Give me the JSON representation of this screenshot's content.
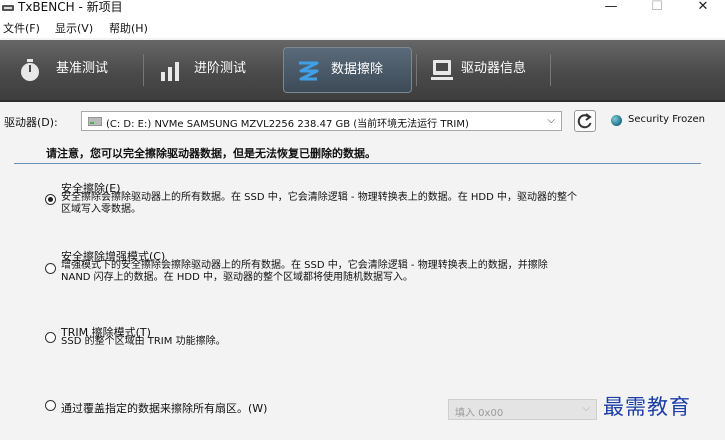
{
  "window": {
    "title": "TxBENCH - 新项目",
    "minimize": "—",
    "maximize": "☐",
    "close": "✕"
  },
  "menu": {
    "items": [
      "文件(F)",
      "显示(V)",
      "帮助(H)"
    ]
  },
  "tabs": [
    {
      "label": "基准测试",
      "icon": "stopwatch-icon",
      "active": false
    },
    {
      "label": "进阶测试",
      "icon": "bar-chart-icon",
      "active": false
    },
    {
      "label": "数据擦除",
      "icon": "erase-icon",
      "active": true
    },
    {
      "label": "驱动器信息",
      "icon": "drive-info-icon",
      "active": false
    }
  ],
  "drive": {
    "label": "驱动器(D):",
    "selected": "(C: D: E:) NVMe SAMSUNG MZVL2256  238.47 GB (当前环境无法运行 TRIM)",
    "security_status": "Security Frozen",
    "security_color": "#1c6f87"
  },
  "warning": "请注意，您可以完全擦除驱动器数据，但是无法恢复已删除的数据。",
  "options": [
    {
      "title": "安全擦除(E)",
      "selected": true,
      "desc": [
        "安全擦除会擦除驱动器上的所有数据。在 SSD 中，它会清除逻辑 - 物理转换表上的数据。在 HDD 中，驱动器的整个",
        "区域写入零数据。"
      ]
    },
    {
      "title": "安全擦除增强模式(C)",
      "selected": false,
      "desc": [
        "增强模式下的安全擦除会擦除驱动器上的所有数据。在 SSD 中，它会清除逻辑 - 物理转换表上的数据，并擦除",
        "NAND 闪存上的数据。在 HDD 中，驱动器的整个区域都将使用随机数据写入。"
      ]
    },
    {
      "title": "TRIM 擦除模式(T)",
      "selected": false,
      "desc": [
        "SSD 的整个区域由 TRIM 功能擦除。"
      ]
    },
    {
      "title": "通过覆盖指定的数据来擦除所有扇区。(W)",
      "selected": false,
      "desc": []
    }
  ],
  "fill_select": {
    "value": "填入 0x00"
  },
  "watermark": "最需教育"
}
